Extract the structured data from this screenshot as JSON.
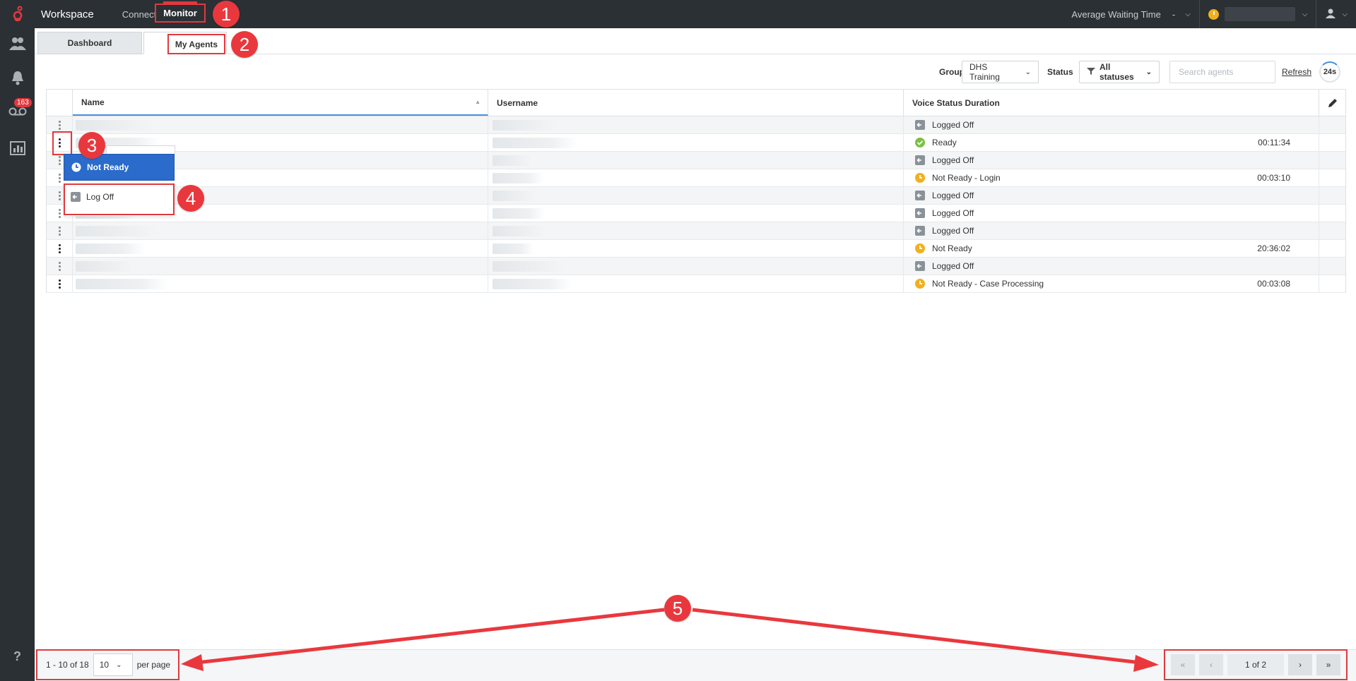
{
  "app": {
    "title": "Workspace"
  },
  "nav": {
    "connect": "Connect",
    "monitor": "Monitor"
  },
  "topbar": {
    "awt_label": "Average Waiting Time",
    "awt_value": "-"
  },
  "sidebar": {
    "badge_count": "163",
    "help": "?"
  },
  "tabs": {
    "dashboard": "Dashboard",
    "my_agents": "My Agents"
  },
  "filters": {
    "groups_label": "Groups",
    "groups_value": "DHS Training",
    "status_label": "Status",
    "status_value": "All statuses",
    "search_placeholder": "Search agents",
    "refresh": "Refresh",
    "timer": "24s"
  },
  "table": {
    "columns": {
      "name": "Name",
      "username": "Username",
      "status": "Voice Status Duration"
    },
    "rows": [
      {
        "status": "Logged Off",
        "icon": "logged-off",
        "duration": ""
      },
      {
        "status": "Ready",
        "icon": "ready",
        "duration": "00:11:34"
      },
      {
        "status": "Logged Off",
        "icon": "logged-off",
        "duration": ""
      },
      {
        "status": "Not Ready - Login",
        "icon": "not-ready",
        "duration": "00:03:10"
      },
      {
        "status": "Logged Off",
        "icon": "logged-off",
        "duration": ""
      },
      {
        "status": "Logged Off",
        "icon": "logged-off",
        "duration": ""
      },
      {
        "status": "Logged Off",
        "icon": "logged-off",
        "duration": ""
      },
      {
        "status": "Not Ready",
        "icon": "not-ready",
        "duration": "20:36:02"
      },
      {
        "status": "Logged Off",
        "icon": "logged-off",
        "duration": ""
      },
      {
        "status": "Not Ready - Case Processing",
        "icon": "not-ready",
        "duration": "00:03:08"
      }
    ]
  },
  "context_menu": {
    "not_ready": "Not Ready",
    "log_off": "Log Off"
  },
  "pagination": {
    "range": "1 - 10 of 18",
    "per_page_value": "10",
    "per_page_label": "per page",
    "page_info": "1 of 2",
    "first": "«",
    "prev": "‹",
    "next": "›",
    "last": "»"
  },
  "callouts": [
    "1",
    "2",
    "3",
    "4",
    "5"
  ],
  "colors": {
    "accent": "#e0393e",
    "selected": "#2a6bcc",
    "ready": "#7ac143",
    "not_ready": "#f2b01e",
    "logged_off": "#8a9299"
  }
}
